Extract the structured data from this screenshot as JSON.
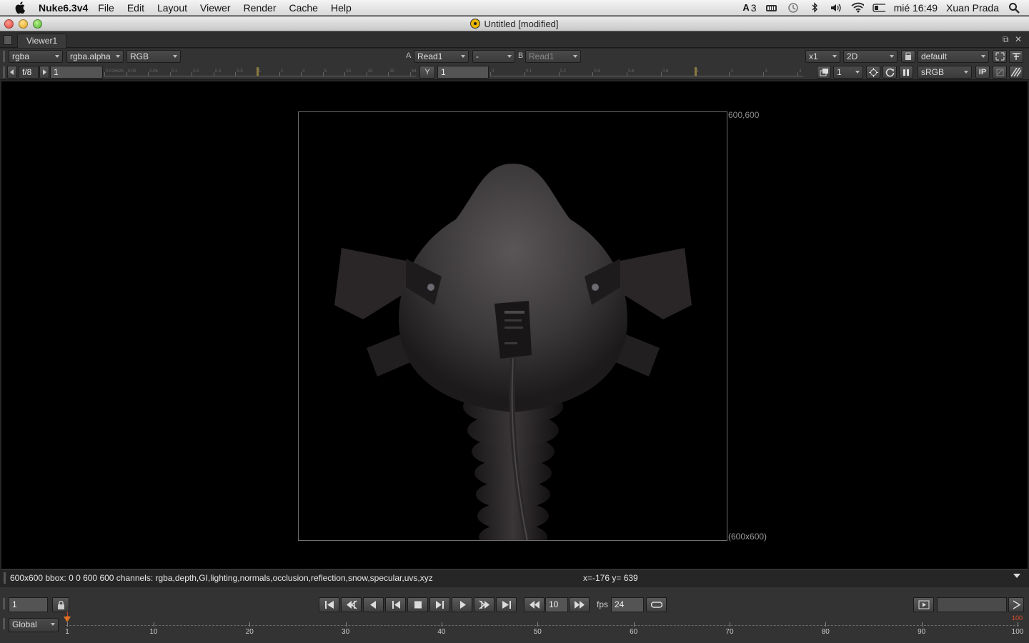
{
  "menubar": {
    "app_name": "Nuke6.3v4",
    "items": [
      "File",
      "Edit",
      "Layout",
      "Viewer",
      "Render",
      "Cache",
      "Help"
    ],
    "adobe_count": "3",
    "clock": "mié 16:49",
    "user": "Xuan Prada"
  },
  "window": {
    "title": "Untitled [modified]"
  },
  "viewer": {
    "tab_label": "Viewer1",
    "channels": "rgba",
    "alpha_channel": "rgba.alpha",
    "display_channels": "RGB",
    "input_a_label": "A",
    "input_a": "Read1",
    "operation": "-",
    "input_b_label": "B",
    "input_b": "Read1",
    "zoom": "x1",
    "view_mode": "2D",
    "lut_profile": "default",
    "fstop": "f/8",
    "gain_value": "1",
    "gamma_label": "Y",
    "gamma_value": "1",
    "proxy_value": "1",
    "colorspace": "sRGB",
    "ip_label": "IP",
    "format_top_right": "600,600",
    "format_bottom_right": "(600x600)"
  },
  "gain_ruler": {
    "ticks": [
      "0.015625",
      "0.03",
      "0.06",
      "0.1",
      "0.2",
      "0.3",
      "0.5",
      "1",
      "2",
      "3",
      "5",
      "10",
      "20",
      "30",
      "64"
    ],
    "marker": "1"
  },
  "gamma_ruler": {
    "ticks": [
      "0",
      "0.1",
      "0.2",
      "0.4",
      "0.6",
      "0.8",
      "1",
      "2",
      "3",
      "4"
    ],
    "marker": "1"
  },
  "infobar": {
    "info": "600x600 bbox: 0 0 600 600 channels: rgba,depth,GI,lighting,normals,occlusion,reflection,snow,specular,uvs,xyz",
    "coords": "x=-176 y= 639"
  },
  "playback": {
    "current_frame": "1",
    "increment": "10",
    "fps_label": "fps",
    "fps": "24",
    "range_mode": "Global",
    "timeline_start": 1,
    "timeline_end": 100,
    "current_marker": "1",
    "end_marker": "100",
    "ticks": [
      "1",
      "10",
      "20",
      "30",
      "40",
      "50",
      "60",
      "70",
      "80",
      "90",
      "100"
    ]
  },
  "colors": {
    "accent_orange": "#e07020",
    "viewport_bg": "#000000",
    "panel_bg": "#333333"
  },
  "icons": [
    "apple-icon",
    "search-icon",
    "wifi-icon",
    "volume-icon",
    "bluetooth-icon",
    "battery-icon",
    "time-machine-icon",
    "nuke-badge-icon"
  ]
}
